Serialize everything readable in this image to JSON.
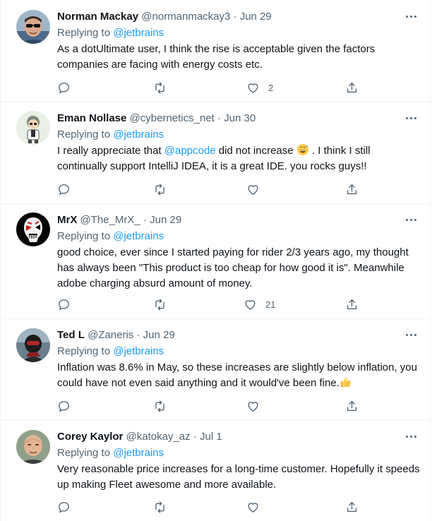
{
  "colors": {
    "link": "#1d9bf0",
    "muted": "#536471",
    "text": "#0f1419",
    "border": "#eff3f4"
  },
  "tweets": [
    {
      "name": "Norman Mackay",
      "handle": "@normanmackay3",
      "dot": "·",
      "date": "Jun 29",
      "replying_label": "Replying to ",
      "replying_to": "@jetbrains",
      "text_parts": [
        "As a dotUltimate user, I think the rise is acceptable given the factors companies are facing with energy costs etc."
      ],
      "likes": "2",
      "avatar_icon": "avatar-sunglasses-man"
    },
    {
      "name": "Eman Nollase",
      "handle": "@cybernetics_net",
      "dot": "·",
      "date": "Jun 30",
      "replying_label": "Replying to ",
      "replying_to": "@jetbrains",
      "text_parts": [
        "I really appreciate that ",
        "@appcode",
        " did not increase ",
        " . I think I still continually support IntelliJ IDEA, it is a great IDE. you rocks guys!!"
      ],
      "emoji": "grinning-sweat-emoji",
      "likes": "",
      "avatar_icon": "avatar-cartoon-character"
    },
    {
      "name": "MrX",
      "handle": "@The_MrX_",
      "dot": "·",
      "date": "Jun 29",
      "replying_label": "Replying to ",
      "replying_to": "@jetbrains",
      "text_parts": [
        "good choice, ever since I started paying for rider 2/3 years ago, my thought has always been \"This product is too cheap for how good it is\". Meanwhile adobe charging absurd amount of money."
      ],
      "likes": "21",
      "avatar_icon": "avatar-hollow-mask"
    },
    {
      "name": "Ted L",
      "handle": "@Zaneris",
      "dot": "·",
      "date": "Jun 29",
      "replying_label": "Replying to ",
      "replying_to": "@jetbrains",
      "text_parts": [
        "Inflation was 8.6% in May, so these increases are slightly below inflation, you could have not even said anything and it would've been fine."
      ],
      "emoji": "thumbs-up-emoji",
      "likes": "",
      "avatar_icon": "avatar-helmet-rider"
    },
    {
      "name": "Corey Kaylor",
      "handle": "@katokay_az",
      "dot": "·",
      "date": "Jul 1",
      "replying_label": "Replying to ",
      "replying_to": "@jetbrains",
      "text_parts": [
        "Very reasonable price increases for a long-time customer. Hopefully it speeds up making Fleet awesome and more available."
      ],
      "likes": "",
      "avatar_icon": "avatar-bald-man"
    }
  ]
}
